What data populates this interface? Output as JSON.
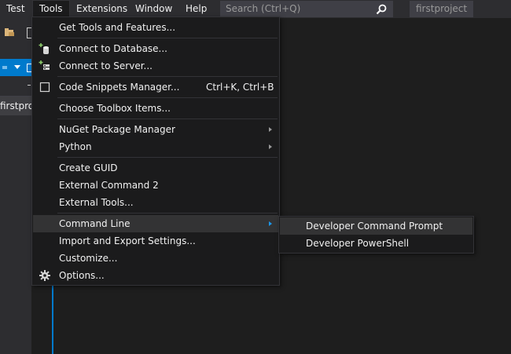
{
  "menubar": {
    "items": [
      {
        "label": "Test"
      },
      {
        "label": "Tools"
      },
      {
        "label": "Extensions"
      },
      {
        "label": "Window"
      },
      {
        "label": "Help"
      }
    ],
    "active_item": "Tools",
    "search_placeholder": "Search (Ctrl+Q)",
    "project_name": "firstproject"
  },
  "left_panel": {
    "partial_tab_label": "firstproje"
  },
  "tools_menu": {
    "items": [
      {
        "label": "Get Tools and Features...",
        "icon": null
      },
      {
        "label": "Connect to Database...",
        "icon": "database-icon"
      },
      {
        "label": "Connect to Server...",
        "icon": "server-icon"
      },
      {
        "label": "Code Snippets Manager...",
        "shortcut": "Ctrl+K, Ctrl+B",
        "icon": "checkbox-icon"
      },
      {
        "label": "Choose Toolbox Items...",
        "icon": null
      },
      {
        "label": "NuGet Package Manager",
        "submenu": true
      },
      {
        "label": "Python",
        "submenu": true
      },
      {
        "label": "Create GUID"
      },
      {
        "label": "External Command 2"
      },
      {
        "label": "External Tools..."
      },
      {
        "label": "Command Line",
        "submenu": true,
        "highlighted": true
      },
      {
        "label": "Import and Export Settings..."
      },
      {
        "label": "Customize..."
      },
      {
        "label": "Options...",
        "icon": "gear-icon"
      }
    ]
  },
  "command_line_submenu": {
    "items": [
      {
        "label": "Developer Command Prompt",
        "highlighted": true
      },
      {
        "label": "Developer PowerShell"
      }
    ]
  },
  "colors": {
    "menubar_bg": "#2d2d30",
    "menu_bg": "#1b1b1c",
    "highlight": "#333334",
    "accent": "#007acc",
    "text": "#f1f1f1"
  }
}
